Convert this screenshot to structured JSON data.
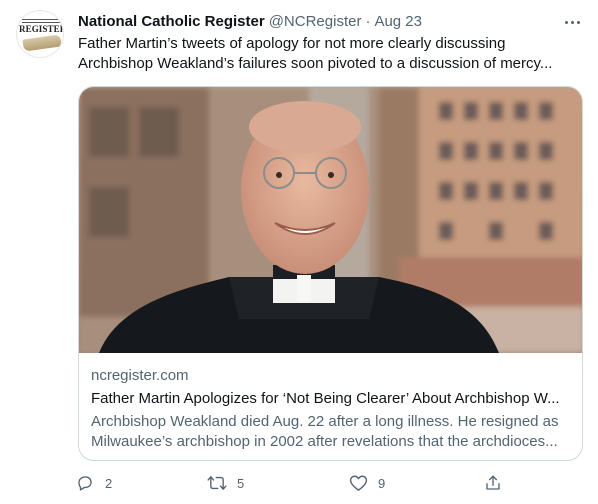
{
  "tweet": {
    "author_name": "National Catholic Register",
    "handle": "@NCRegister",
    "separator": "·",
    "date": "Aug 23",
    "avatar_text": "REGISTER",
    "text_lines": [
      "Father Martin’s tweets of apology for not more clearly discussing",
      "Archbishop Weakland’s failures soon pivoted to a discussion of mercy..."
    ]
  },
  "card": {
    "domain": "ncregister.com",
    "title": "Father Martin Apologizes for ‘Not Being Clearer’ About Archbishop W...",
    "description_lines": [
      "Archbishop Weakland died Aug. 22 after a long illness. He resigned as",
      "Milwaukee’s archbishop in 2002 after revelations that the archdioces..."
    ]
  },
  "actions": {
    "reply": {
      "icon": "reply-icon",
      "count": "2"
    },
    "retweet": {
      "icon": "retweet-icon",
      "count": "5"
    },
    "like": {
      "icon": "heart-icon",
      "count": "9"
    },
    "share": {
      "icon": "share-icon"
    }
  },
  "colors": {
    "text_primary": "#0f1419",
    "text_secondary": "#536471",
    "border": "#cfd9de"
  }
}
